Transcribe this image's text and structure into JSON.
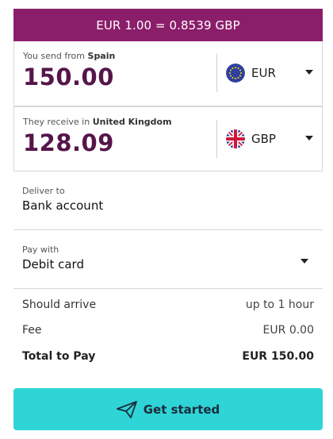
{
  "rate": {
    "text": "EUR 1.00 = 0.8539 GBP"
  },
  "send": {
    "label_prefix": "You send from",
    "country": "Spain",
    "amount": "150.00",
    "currency": "EUR"
  },
  "receive": {
    "label_prefix": "They receive in",
    "country": "United Kingdom",
    "amount": "128.09",
    "currency": "GBP"
  },
  "deliver": {
    "label": "Deliver to",
    "value": "Bank account"
  },
  "pay": {
    "label": "Pay with",
    "value": "Debit card"
  },
  "summary": {
    "arrive_label": "Should arrive",
    "arrive_value": "up to 1 hour",
    "fee_label": "Fee",
    "fee_value": "EUR 0.00",
    "total_label": "Total to Pay",
    "total_value": "EUR 150.00"
  },
  "cta": {
    "label": "Get started"
  },
  "colors": {
    "rate_bar": "#8b1e6b",
    "amount": "#55154a",
    "cta": "#2fd4d6"
  },
  "icons": {
    "eur_flag": "eu-flag-icon",
    "gbp_flag": "uk-flag-icon",
    "cta_icon": "paper-plane-icon",
    "caret": "chevron-down-icon"
  }
}
